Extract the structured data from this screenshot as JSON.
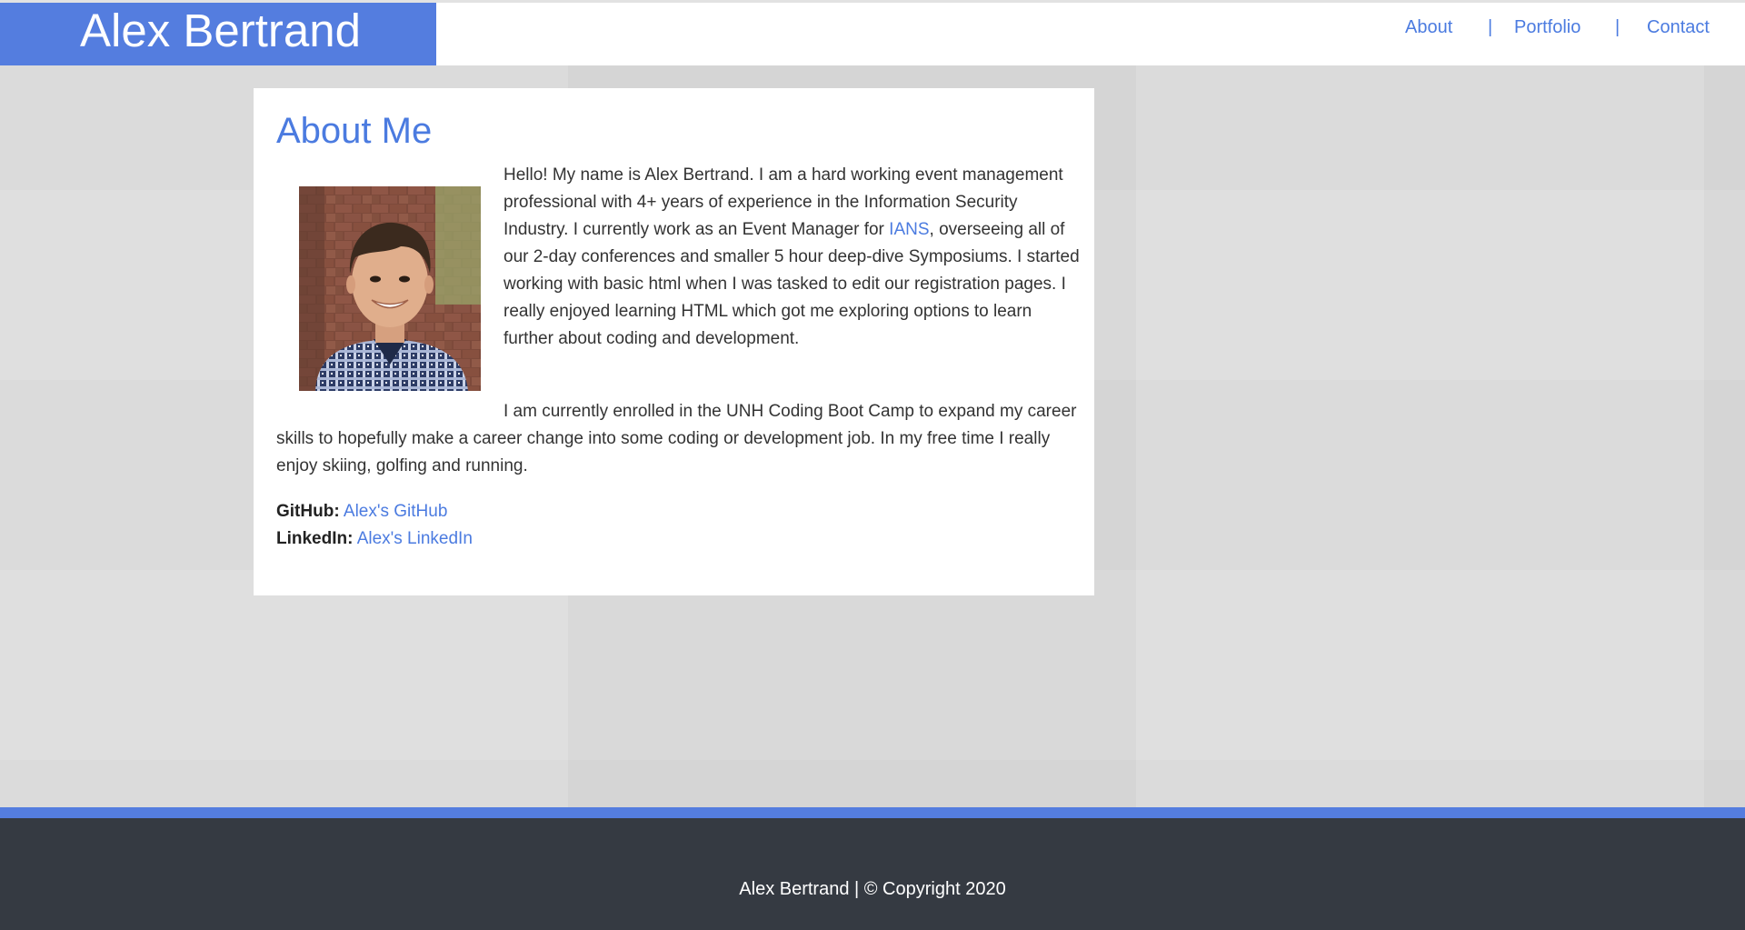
{
  "header": {
    "brand_name": "Alex Bertrand",
    "nav": [
      {
        "label": "About"
      },
      {
        "label": "Portfolio"
      },
      {
        "label": "Contact"
      }
    ],
    "separator": "|"
  },
  "about": {
    "title": "About Me",
    "paragraph1": {
      "before_link": "Hello! My name is Alex Bertrand. I am a hard working event management professional with 4+ years of experience in the Information Security Industry. I currently work as an Event Manager for ",
      "link_text": "IANS",
      "after_link": ", overseeing all of our 2-day conferences and smaller 5 hour deep-dive Symposiums. I started working with basic html when I was tasked to edit our registration pages. I really enjoyed learning HTML which got me exploring options to learn further about coding and development."
    },
    "paragraph2": "I am currently enrolled in the UNH Coding Boot Camp to expand my career skills to hopefully make a career change into some coding or development job. In my free time I really enjoy skiing, golfing and running.",
    "github": {
      "label": "GitHub:",
      "link_text": "Alex's GitHub"
    },
    "linkedin": {
      "label": "LinkedIn:",
      "link_text": "Alex's LinkedIn"
    }
  },
  "footer": {
    "text": "Alex Bertrand | © Copyright 2020"
  },
  "colors": {
    "accent": "#547ddf",
    "link": "#4b7be0",
    "footer_bg": "#353a42",
    "page_bg": "#dcdcdc"
  },
  "icons": {
    "photo": "profile-photo"
  }
}
